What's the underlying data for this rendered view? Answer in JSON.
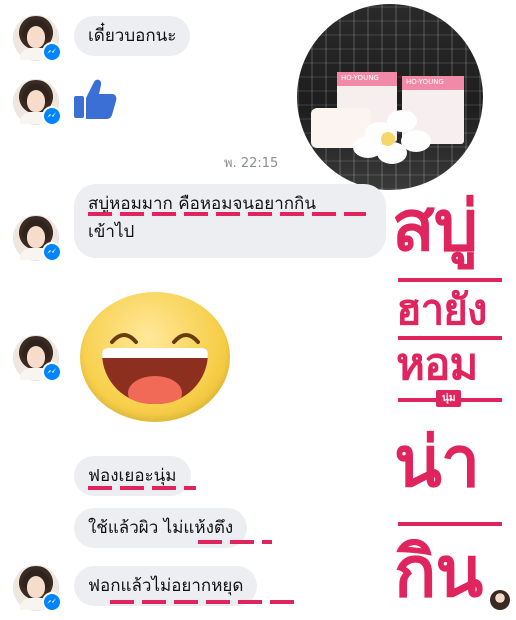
{
  "chat": {
    "messages": [
      {
        "text": "เดี๋ยวบอกนะ"
      },
      {
        "text": "สบู่หอมมาก คือหอมจนอยากกิน"
      },
      {
        "text": "เข้าไป"
      },
      {
        "text": "ฟองเยอะนุ่ม"
      },
      {
        "text": "ใช้แล้วผิว ไม่แห้งตึง"
      },
      {
        "text": "ฟอกแล้วไม่อยากหยุด"
      }
    ],
    "timestamp": "พ. 22:15"
  },
  "photo": {
    "box_label": "HO-YOUNG"
  },
  "title": {
    "line1": "สบู่",
    "line2": "ฮายัง",
    "line3": "หอม",
    "tag": "นุ่ม",
    "line4": "น่า",
    "line5": "กิน"
  },
  "colors": {
    "accent": "#e0245e",
    "bubble": "#eceef1",
    "messenger_blue": "#0084ff",
    "like_blue": "#3b6fd6"
  },
  "icons": {
    "like": "thumbs-up-icon",
    "badge": "messenger-icon",
    "emoji": "laughing-face-icon"
  }
}
